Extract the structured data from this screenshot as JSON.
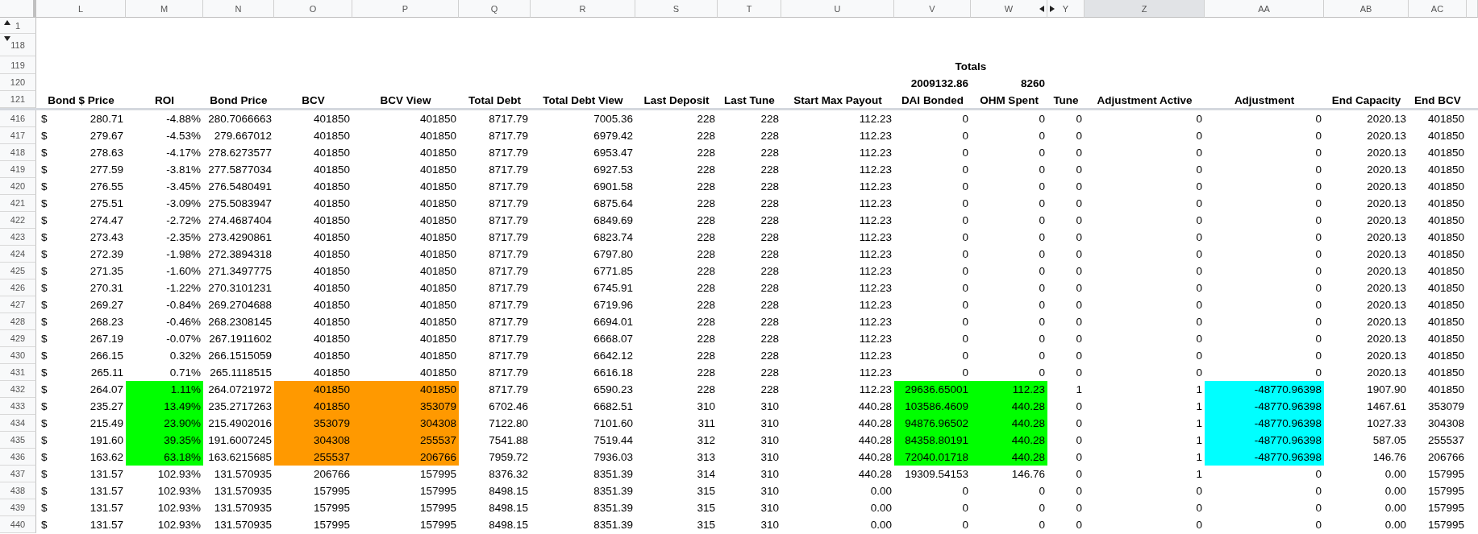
{
  "columns": [
    {
      "letter": "L",
      "header": "Bond $ Price",
      "selected": false
    },
    {
      "letter": "M",
      "header": "ROI",
      "selected": false
    },
    {
      "letter": "N",
      "header": "Bond Price",
      "selected": false
    },
    {
      "letter": "O",
      "header": "BCV",
      "selected": false
    },
    {
      "letter": "P",
      "header": "BCV View",
      "selected": false
    },
    {
      "letter": "Q",
      "header": "Total Debt",
      "selected": false
    },
    {
      "letter": "R",
      "header": "Total Debt View",
      "selected": false
    },
    {
      "letter": "S",
      "header": "Last Deposit",
      "selected": false
    },
    {
      "letter": "T",
      "header": "Last Tune",
      "selected": false
    },
    {
      "letter": "U",
      "header": "Start Max Payout",
      "selected": false
    },
    {
      "letter": "V",
      "header": "DAI Bonded",
      "selected": false
    },
    {
      "letter": "W",
      "header": "OHM Spent",
      "selected": false
    },
    {
      "letter": "Y",
      "header": "Tune",
      "selected": false
    },
    {
      "letter": "Z",
      "header": "Adjustment Active",
      "selected": true
    },
    {
      "letter": "AA",
      "header": "Adjustment",
      "selected": false
    },
    {
      "letter": "AB",
      "header": "End Capacity",
      "selected": false
    },
    {
      "letter": "AC",
      "header": "End BCV",
      "selected": false
    }
  ],
  "top_rows": [
    "1",
    "118",
    "119",
    "120",
    "121"
  ],
  "totals": {
    "label": "Totals",
    "dai_bonded": "2009132.86",
    "ohm_spent": "8260"
  },
  "rows": [
    {
      "row": "416",
      "currency": "$",
      "cells": [
        "280.71",
        "-4.88%",
        "280.7066663",
        "401850",
        "401850",
        "8717.79",
        "7005.36",
        "228",
        "228",
        "112.23",
        "0",
        "0",
        "0",
        "0",
        "0",
        "2020.13",
        "401850"
      ]
    },
    {
      "row": "417",
      "currency": "$",
      "cells": [
        "279.67",
        "-4.53%",
        "279.667012",
        "401850",
        "401850",
        "8717.79",
        "6979.42",
        "228",
        "228",
        "112.23",
        "0",
        "0",
        "0",
        "0",
        "0",
        "2020.13",
        "401850"
      ]
    },
    {
      "row": "418",
      "currency": "$",
      "cells": [
        "278.63",
        "-4.17%",
        "278.6273577",
        "401850",
        "401850",
        "8717.79",
        "6953.47",
        "228",
        "228",
        "112.23",
        "0",
        "0",
        "0",
        "0",
        "0",
        "2020.13",
        "401850"
      ]
    },
    {
      "row": "419",
      "currency": "$",
      "cells": [
        "277.59",
        "-3.81%",
        "277.5877034",
        "401850",
        "401850",
        "8717.79",
        "6927.53",
        "228",
        "228",
        "112.23",
        "0",
        "0",
        "0",
        "0",
        "0",
        "2020.13",
        "401850"
      ]
    },
    {
      "row": "420",
      "currency": "$",
      "cells": [
        "276.55",
        "-3.45%",
        "276.5480491",
        "401850",
        "401850",
        "8717.79",
        "6901.58",
        "228",
        "228",
        "112.23",
        "0",
        "0",
        "0",
        "0",
        "0",
        "2020.13",
        "401850"
      ]
    },
    {
      "row": "421",
      "currency": "$",
      "cells": [
        "275.51",
        "-3.09%",
        "275.5083947",
        "401850",
        "401850",
        "8717.79",
        "6875.64",
        "228",
        "228",
        "112.23",
        "0",
        "0",
        "0",
        "0",
        "0",
        "2020.13",
        "401850"
      ]
    },
    {
      "row": "422",
      "currency": "$",
      "cells": [
        "274.47",
        "-2.72%",
        "274.4687404",
        "401850",
        "401850",
        "8717.79",
        "6849.69",
        "228",
        "228",
        "112.23",
        "0",
        "0",
        "0",
        "0",
        "0",
        "2020.13",
        "401850"
      ]
    },
    {
      "row": "423",
      "currency": "$",
      "cells": [
        "273.43",
        "-2.35%",
        "273.4290861",
        "401850",
        "401850",
        "8717.79",
        "6823.74",
        "228",
        "228",
        "112.23",
        "0",
        "0",
        "0",
        "0",
        "0",
        "2020.13",
        "401850"
      ]
    },
    {
      "row": "424",
      "currency": "$",
      "cells": [
        "272.39",
        "-1.98%",
        "272.3894318",
        "401850",
        "401850",
        "8717.79",
        "6797.80",
        "228",
        "228",
        "112.23",
        "0",
        "0",
        "0",
        "0",
        "0",
        "2020.13",
        "401850"
      ]
    },
    {
      "row": "425",
      "currency": "$",
      "cells": [
        "271.35",
        "-1.60%",
        "271.3497775",
        "401850",
        "401850",
        "8717.79",
        "6771.85",
        "228",
        "228",
        "112.23",
        "0",
        "0",
        "0",
        "0",
        "0",
        "2020.13",
        "401850"
      ]
    },
    {
      "row": "426",
      "currency": "$",
      "cells": [
        "270.31",
        "-1.22%",
        "270.3101231",
        "401850",
        "401850",
        "8717.79",
        "6745.91",
        "228",
        "228",
        "112.23",
        "0",
        "0",
        "0",
        "0",
        "0",
        "2020.13",
        "401850"
      ]
    },
    {
      "row": "427",
      "currency": "$",
      "cells": [
        "269.27",
        "-0.84%",
        "269.2704688",
        "401850",
        "401850",
        "8717.79",
        "6719.96",
        "228",
        "228",
        "112.23",
        "0",
        "0",
        "0",
        "0",
        "0",
        "2020.13",
        "401850"
      ]
    },
    {
      "row": "428",
      "currency": "$",
      "cells": [
        "268.23",
        "-0.46%",
        "268.2308145",
        "401850",
        "401850",
        "8717.79",
        "6694.01",
        "228",
        "228",
        "112.23",
        "0",
        "0",
        "0",
        "0",
        "0",
        "2020.13",
        "401850"
      ]
    },
    {
      "row": "429",
      "currency": "$",
      "cells": [
        "267.19",
        "-0.07%",
        "267.1911602",
        "401850",
        "401850",
        "8717.79",
        "6668.07",
        "228",
        "228",
        "112.23",
        "0",
        "0",
        "0",
        "0",
        "0",
        "2020.13",
        "401850"
      ]
    },
    {
      "row": "430",
      "currency": "$",
      "cells": [
        "266.15",
        "0.32%",
        "266.1515059",
        "401850",
        "401850",
        "8717.79",
        "6642.12",
        "228",
        "228",
        "112.23",
        "0",
        "0",
        "0",
        "0",
        "0",
        "2020.13",
        "401850"
      ]
    },
    {
      "row": "431",
      "currency": "$",
      "cells": [
        "265.11",
        "0.71%",
        "265.1118515",
        "401850",
        "401850",
        "8717.79",
        "6616.18",
        "228",
        "228",
        "112.23",
        "0",
        "0",
        "0",
        "0",
        "0",
        "2020.13",
        "401850"
      ]
    },
    {
      "row": "432",
      "currency": "$",
      "cells": [
        "264.07",
        {
          "text": "1.11%",
          "color": "#00ff00"
        },
        "264.0721972",
        {
          "text": "401850",
          "color": "#ff9900"
        },
        {
          "text": "401850",
          "color": "#ff9900"
        },
        "8717.79",
        "6590.23",
        "228",
        "228",
        "112.23",
        {
          "text": "29636.65001",
          "color": "#00ff00"
        },
        {
          "text": "112.23",
          "color": "#00ff00"
        },
        "1",
        "1",
        {
          "text": "-48770.96398",
          "color": "#00ffff"
        },
        "1907.90",
        "401850"
      ]
    },
    {
      "row": "433",
      "currency": "$",
      "cells": [
        "235.27",
        {
          "text": "13.49%",
          "color": "#00ff00"
        },
        "235.2717263",
        {
          "text": "401850",
          "color": "#ff9900"
        },
        {
          "text": "353079",
          "color": "#ff9900"
        },
        "6702.46",
        "6682.51",
        "310",
        "310",
        "440.28",
        {
          "text": "103586.4609",
          "color": "#00ff00"
        },
        {
          "text": "440.28",
          "color": "#00ff00"
        },
        "0",
        "1",
        {
          "text": "-48770.96398",
          "color": "#00ffff"
        },
        "1467.61",
        "353079"
      ]
    },
    {
      "row": "434",
      "currency": "$",
      "cells": [
        "215.49",
        {
          "text": "23.90%",
          "color": "#00ff00"
        },
        "215.4902016",
        {
          "text": "353079",
          "color": "#ff9900"
        },
        {
          "text": "304308",
          "color": "#ff9900"
        },
        "7122.80",
        "7101.60",
        "311",
        "310",
        "440.28",
        {
          "text": "94876.96502",
          "color": "#00ff00"
        },
        {
          "text": "440.28",
          "color": "#00ff00"
        },
        "0",
        "1",
        {
          "text": "-48770.96398",
          "color": "#00ffff"
        },
        "1027.33",
        "304308"
      ]
    },
    {
      "row": "435",
      "currency": "$",
      "cells": [
        "191.60",
        {
          "text": "39.35%",
          "color": "#00ff00"
        },
        "191.6007245",
        {
          "text": "304308",
          "color": "#ff9900"
        },
        {
          "text": "255537",
          "color": "#ff9900"
        },
        "7541.88",
        "7519.44",
        "312",
        "310",
        "440.28",
        {
          "text": "84358.80191",
          "color": "#00ff00"
        },
        {
          "text": "440.28",
          "color": "#00ff00"
        },
        "0",
        "1",
        {
          "text": "-48770.96398",
          "color": "#00ffff"
        },
        "587.05",
        "255537"
      ]
    },
    {
      "row": "436",
      "currency": "$",
      "cells": [
        "163.62",
        {
          "text": "63.18%",
          "color": "#00ff00"
        },
        "163.6215685",
        {
          "text": "255537",
          "color": "#ff9900"
        },
        {
          "text": "206766",
          "color": "#ff9900"
        },
        "7959.72",
        "7936.03",
        "313",
        "310",
        "440.28",
        {
          "text": "72040.01718",
          "color": "#00ff00"
        },
        {
          "text": "440.28",
          "color": "#00ff00"
        },
        "0",
        "1",
        {
          "text": "-48770.96398",
          "color": "#00ffff"
        },
        "146.76",
        "206766"
      ]
    },
    {
      "row": "437",
      "currency": "$",
      "cells": [
        "131.57",
        "102.93%",
        "131.570935",
        "206766",
        "157995",
        "8376.32",
        "8351.39",
        "314",
        "310",
        "440.28",
        "19309.54153",
        "146.76",
        "0",
        "1",
        "0",
        "0.00",
        "157995"
      ]
    },
    {
      "row": "438",
      "currency": "$",
      "cells": [
        "131.57",
        "102.93%",
        "131.570935",
        "157995",
        "157995",
        "8498.15",
        "8351.39",
        "315",
        "310",
        "0.00",
        "0",
        "0",
        "0",
        "0",
        "0",
        "0.00",
        "157995"
      ]
    },
    {
      "row": "439",
      "currency": "$",
      "cells": [
        "131.57",
        "102.93%",
        "131.570935",
        "157995",
        "157995",
        "8498.15",
        "8351.39",
        "315",
        "310",
        "0.00",
        "0",
        "0",
        "0",
        "0",
        "0",
        "0.00",
        "157995"
      ]
    },
    {
      "row": "440",
      "currency": "$",
      "cells": [
        "131.57",
        "102.93%",
        "131.570935",
        "157995",
        "157995",
        "8498.15",
        "8351.39",
        "315",
        "310",
        "0.00",
        "0",
        "0",
        "0",
        "0",
        "0",
        "0.00",
        "157995"
      ]
    }
  ]
}
